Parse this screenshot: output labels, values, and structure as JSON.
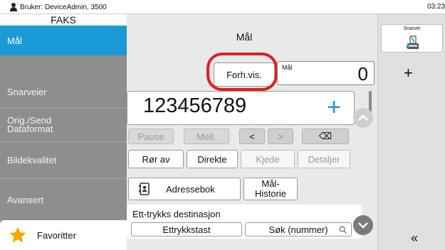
{
  "status": {
    "user": "Bruker: DeviceAdmin, 3500",
    "time": "03:23"
  },
  "sidebar": {
    "title": "FAKS",
    "items": [
      "Mål",
      "Snarveier",
      "Orig./Send Dataformat",
      "Bildekvalitet",
      "Avansert"
    ],
    "favorites": "Favoritter"
  },
  "main": {
    "title": "Mål",
    "preview_button": "Forh.vis.",
    "dest_label": "Mål",
    "dest_count": "0",
    "number": "123456789",
    "keys": [
      "Pause",
      "Mell.",
      "<",
      ">",
      "⌫"
    ],
    "actions": [
      "Rør av",
      "Direkte",
      "Kjede",
      "Detaljer"
    ],
    "address_book": "Adressebok",
    "history": "Mål-Historie",
    "onetouch_header": "Ett-trykks destinasjon",
    "onetouch_key": "Ettrykkstast",
    "search_number": "Søk (nummer)"
  },
  "right": {
    "shortcut": "Snarvei",
    "add": "+",
    "collapse": "«"
  },
  "colors": {
    "accent": "#1a9ad6",
    "highlight": "#e01e1e",
    "star": "#f5a800"
  }
}
